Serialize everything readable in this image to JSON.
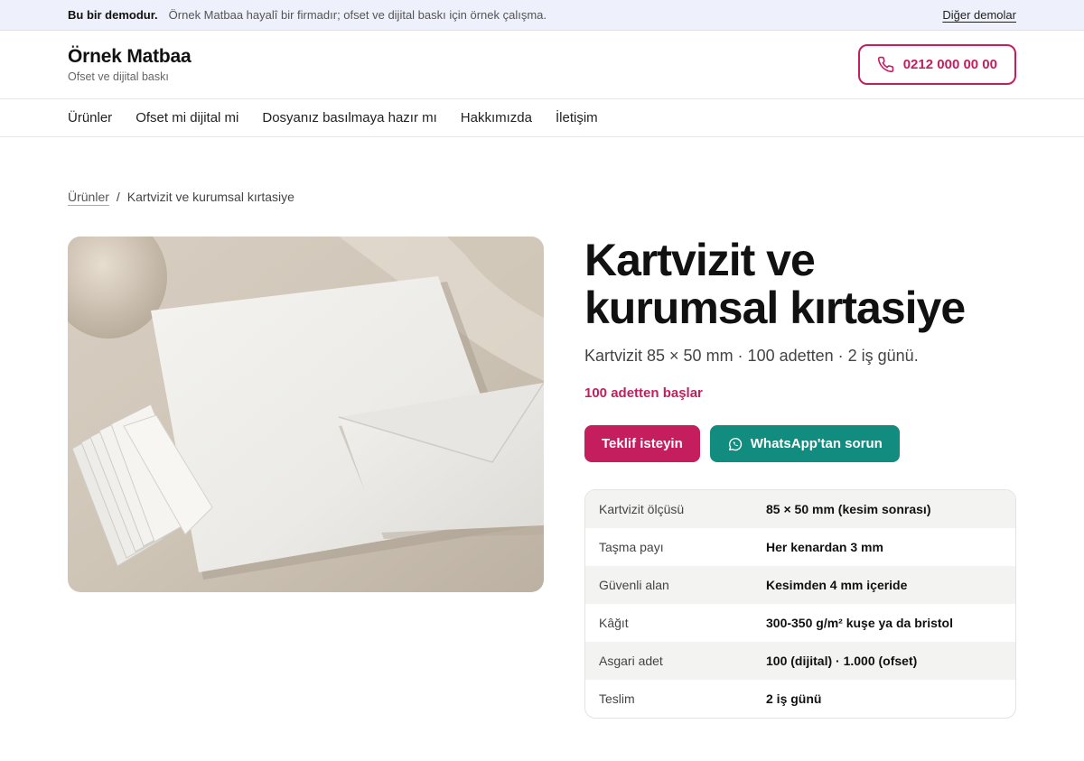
{
  "demo_bar": {
    "strong": "Bu bir demodur.",
    "note": "Örnek Matbaa hayalî bir firmadır; ofset ve dijital baskı için örnek çalışma.",
    "link": "Diğer demolar"
  },
  "header": {
    "brand_name": "Örnek Matbaa",
    "brand_tagline": "Ofset ve dijital baskı",
    "phone": "0212 000 00 00",
    "phone_icon": "phone-icon"
  },
  "nav": {
    "items": [
      "Ürünler",
      "Ofset mi dijital mi",
      "Dosyanız basılmaya hazır mı",
      "Hakkımızda",
      "İletişim"
    ]
  },
  "breadcrumb": {
    "parent": "Ürünler",
    "separator": "/",
    "current": "Kartvizit ve kurumsal kırtasiye"
  },
  "product": {
    "title_line1": "Kartvizit ve",
    "title_line2": "kurumsal kırtasiye",
    "subtitle": "Kartvizit 85 × 50 mm · 100 adetten · 2 iş günü.",
    "price_note": "100 adetten başlar",
    "cta_quote": "Teklif isteyin",
    "cta_whatsapp": "WhatsApp'tan sorun",
    "whatsapp_icon": "whatsapp-icon"
  },
  "specs": [
    {
      "key": "Kartvizit ölçüsü",
      "value": "85 × 50 mm (kesim sonrası)"
    },
    {
      "key": "Taşma payı",
      "value": "Her kenardan 3 mm"
    },
    {
      "key": "Güvenli alan",
      "value": "Kesimden 4 mm içeride"
    },
    {
      "key": "Kâğıt",
      "value": "300-350 g/m² kuşe ya da bristol"
    },
    {
      "key": "Asgari adet",
      "value": "100 (dijital) · 1.000 (ofset)"
    },
    {
      "key": "Teslim",
      "value": "2 iş günü"
    }
  ],
  "colors": {
    "accent": "#c41e5f",
    "whatsapp": "#128c7e",
    "demo_bar_bg": "#eef0fb"
  }
}
